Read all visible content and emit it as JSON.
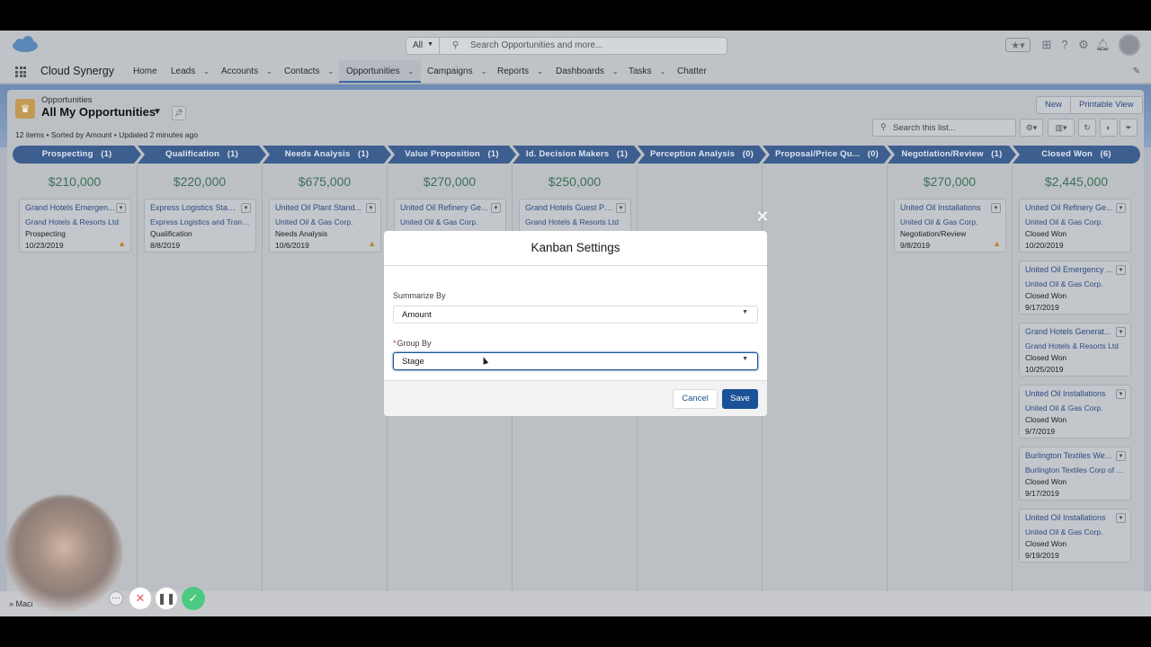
{
  "header": {
    "search_scope": "All",
    "search_placeholder": "Search Opportunities and more..."
  },
  "nav": {
    "app_name": "Cloud Synergy",
    "items": [
      {
        "label": "Home",
        "has_menu": false
      },
      {
        "label": "Leads",
        "has_menu": true
      },
      {
        "label": "Accounts",
        "has_menu": true
      },
      {
        "label": "Contacts",
        "has_menu": true
      },
      {
        "label": "Opportunities",
        "has_menu": true,
        "active": true
      },
      {
        "label": "Campaigns",
        "has_menu": true
      },
      {
        "label": "Reports",
        "has_menu": true
      },
      {
        "label": "Dashboards",
        "has_menu": true
      },
      {
        "label": "Tasks",
        "has_menu": true
      },
      {
        "label": "Chatter",
        "has_menu": false
      }
    ]
  },
  "list": {
    "object_label": "Opportunities",
    "view_title": "All My Opportunities",
    "meta": "12 items • Sorted by Amount • Updated 2 minutes ago",
    "new_button": "New",
    "printable_button": "Printable View",
    "search_placeholder": "Search this list..."
  },
  "kanban": {
    "stages": [
      {
        "label": "Prospecting",
        "count": "(1)",
        "total": "$210,000"
      },
      {
        "label": "Qualification",
        "count": "(1)",
        "total": "$220,000"
      },
      {
        "label": "Needs Analysis",
        "count": "(1)",
        "total": "$675,000"
      },
      {
        "label": "Value Proposition",
        "count": "(1)",
        "total": "$270,000"
      },
      {
        "label": "Id. Decision Makers",
        "count": "(1)",
        "total": "$250,000"
      },
      {
        "label": "Perception Analysis",
        "count": "(0)",
        "total": ""
      },
      {
        "label": "Proposal/Price Qu...",
        "count": "(0)",
        "total": ""
      },
      {
        "label": "Negotiation/Review",
        "count": "(1)",
        "total": "$270,000"
      },
      {
        "label": "Closed Won",
        "count": "(6)",
        "total": "$2,445,000"
      }
    ],
    "cards": [
      {
        "title": "Grand Hotels Emergen...",
        "account": "Grand Hotels & Resorts Ltd",
        "stage": "Prospecting",
        "date": "10/23/2019",
        "warning": true
      },
      {
        "title": "Express Logistics Stand...",
        "account": "Express Logistics and Transport",
        "stage": "Qualification",
        "date": "8/8/2019",
        "warning": false
      },
      {
        "title": "United Oil Plant Stand...",
        "account": "United Oil & Gas Corp.",
        "stage": "Needs Analysis",
        "date": "10/6/2019",
        "warning": true
      },
      {
        "title": "United Oil Refinery Ge...",
        "account": "United Oil & Gas Corp.",
        "stage": "",
        "date": "",
        "warning": false
      },
      {
        "title": "Grand Hotels Guest Po...",
        "account": "Grand Hotels & Resorts Ltd",
        "stage": "",
        "date": "",
        "warning": false
      },
      {
        "title": "United Oil Installations",
        "account": "United Oil & Gas Corp.",
        "stage": "Negotiation/Review",
        "date": "9/8/2019",
        "warning": true
      },
      {
        "title": "United Oil Refinery Ge...",
        "account": "United Oil & Gas Corp.",
        "stage": "Closed Won",
        "date": "10/20/2019",
        "warning": false
      },
      {
        "title": "United Oil Emergency ...",
        "account": "United Oil & Gas Corp.",
        "stage": "Closed Won",
        "date": "9/17/2019",
        "warning": false
      },
      {
        "title": "Grand Hotels Generat...",
        "account": "Grand Hotels & Resorts Ltd",
        "stage": "Closed Won",
        "date": "10/25/2019",
        "warning": false
      },
      {
        "title": "United Oil Installations",
        "account": "United Oil & Gas Corp.",
        "stage": "Closed Won",
        "date": "9/7/2019",
        "warning": false
      },
      {
        "title": "Burlington Textiles We...",
        "account": "Burlington Textiles Corp of A...",
        "stage": "Closed Won",
        "date": "9/17/2019",
        "warning": false
      },
      {
        "title": "United Oil Installations",
        "account": "United Oil & Gas Corp.",
        "stage": "Closed Won",
        "date": "9/19/2019",
        "warning": false
      }
    ]
  },
  "modal": {
    "title": "Kanban Settings",
    "summarize_label": "Summarize By",
    "summarize_value": "Amount",
    "group_label": "Group By",
    "group_required": "*",
    "group_value": "Stage",
    "cancel": "Cancel",
    "save": "Save"
  },
  "recorder": {
    "bottom_label": "Macl"
  },
  "colors": {
    "stage_bar": "#3d5f8f",
    "total_green": "#3d6f55",
    "save_button": "#1b5297",
    "confirm_green": "#4bca81",
    "cancel_red": "#e05b5b"
  }
}
